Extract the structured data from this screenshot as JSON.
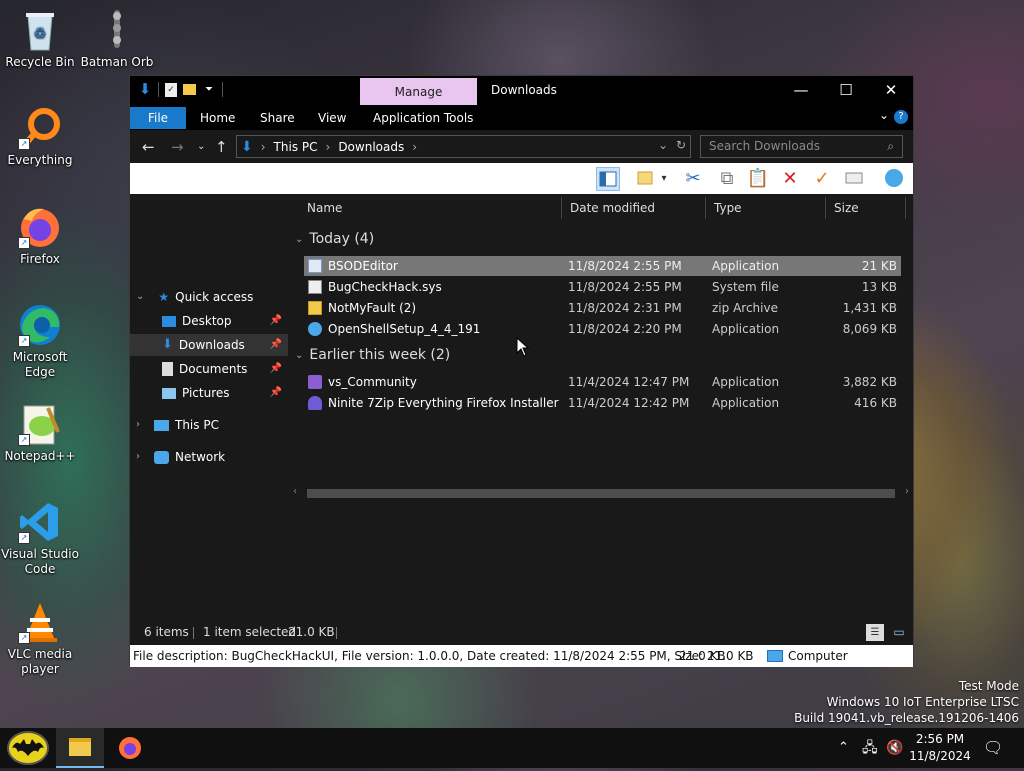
{
  "desktop": {
    "icons": [
      {
        "label": "Recycle Bin"
      },
      {
        "label": "Batman Orb"
      },
      {
        "label": "Everything"
      },
      {
        "label": "Firefox"
      },
      {
        "label": "Microsoft Edge"
      },
      {
        "label": "Notepad++"
      },
      {
        "label": "Visual Studio Code"
      },
      {
        "label": "VLC media player"
      }
    ]
  },
  "window": {
    "title": "Downloads",
    "contextual_tab": "Manage",
    "ribbon_tabs": [
      "File",
      "Home",
      "Share",
      "View",
      "Application Tools"
    ],
    "breadcrumb": [
      "This PC",
      "Downloads"
    ],
    "search_placeholder": "Search Downloads"
  },
  "navpane": {
    "quick_access": "Quick access",
    "items": [
      {
        "label": "Desktop",
        "pinned": true
      },
      {
        "label": "Downloads",
        "pinned": true,
        "selected": true
      },
      {
        "label": "Documents",
        "pinned": true
      },
      {
        "label": "Pictures",
        "pinned": true
      }
    ],
    "this_pc": "This PC",
    "network": "Network"
  },
  "columns": [
    "Name",
    "Date modified",
    "Type",
    "Size"
  ],
  "groups": [
    {
      "label": "Today (4)",
      "files": [
        {
          "name": "BSODEditor",
          "date": "11/8/2024 2:55 PM",
          "type": "Application",
          "size": "21 KB",
          "selected": true,
          "icon": "app-icon"
        },
        {
          "name": "BugCheckHack.sys",
          "date": "11/8/2024 2:55 PM",
          "type": "System file",
          "size": "13 KB",
          "icon": "sys-file-icon"
        },
        {
          "name": "NotMyFault (2)",
          "date": "11/8/2024 2:31 PM",
          "type": "zip Archive",
          "size": "1,431 KB",
          "icon": "zip-icon"
        },
        {
          "name": "OpenShellSetup_4_4_191",
          "date": "11/8/2024 2:20 PM",
          "type": "Application",
          "size": "8,069 KB",
          "icon": "shell-icon"
        }
      ]
    },
    {
      "label": "Earlier this week (2)",
      "files": [
        {
          "name": "vs_Community",
          "date": "11/4/2024 12:47 PM",
          "type": "Application",
          "size": "3,882 KB",
          "icon": "vs-icon"
        },
        {
          "name": "Ninite 7Zip Everything Firefox Installer",
          "date": "11/4/2024 12:42 PM",
          "type": "Application",
          "size": "416 KB",
          "icon": "ninite-icon"
        }
      ]
    }
  ],
  "status": {
    "items": "6 items",
    "selected": "1 item selected",
    "selected_size": "21.0 KB"
  },
  "details_bar": {
    "description": "File description: BugCheckHackUI, File version: 1.0.0.0, Date created: 11/8/2024 2:55 PM, Size: 21.0 KB",
    "size": "21.0 KB",
    "location": "Computer"
  },
  "watermark": {
    "line1": "Test Mode",
    "line2": "Windows 10 IoT Enterprise LTSC",
    "line3": "Build 19041.vb_release.191206-1406"
  },
  "taskbar": {
    "time": "2:56 PM",
    "date": "11/8/2024"
  },
  "colors": {
    "accent": "#1979ca",
    "manage_tab": "#e8c6f0",
    "selection": "#777777"
  }
}
